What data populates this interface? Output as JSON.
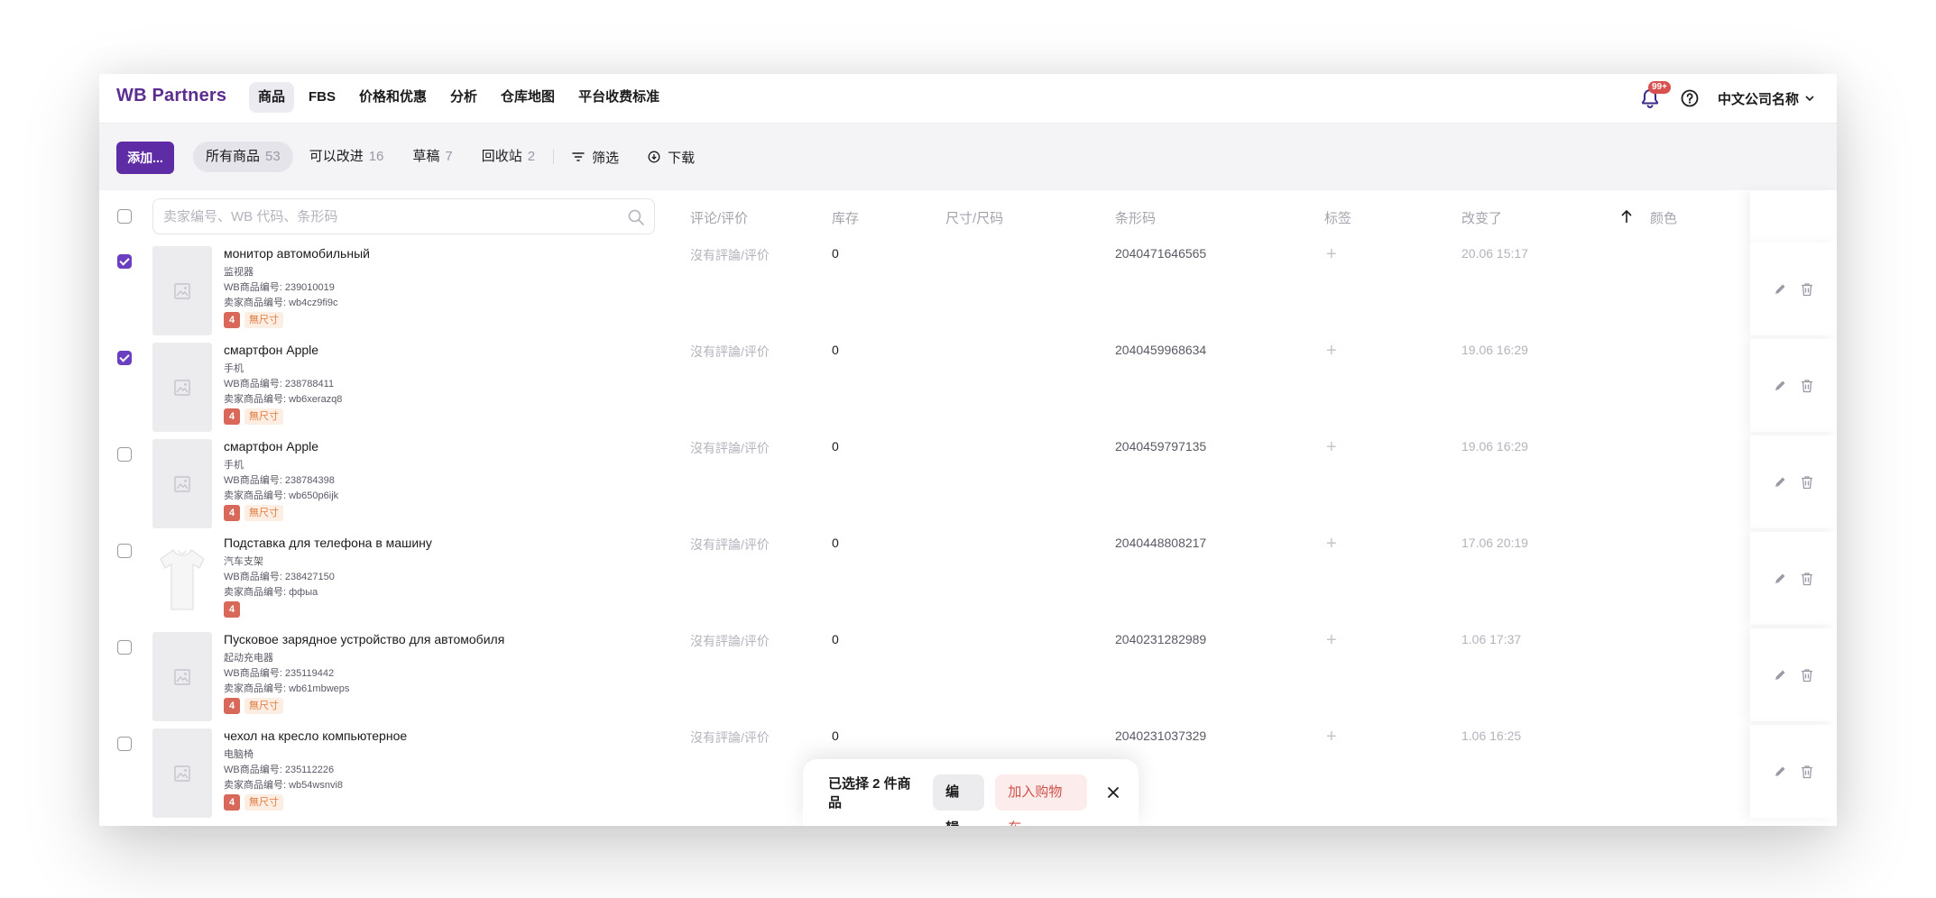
{
  "app": {
    "brand": "WB Partners"
  },
  "nav": {
    "items": [
      "商品",
      "FBS",
      "价格和优惠",
      "分析",
      "仓库地图",
      "平台收费标准"
    ],
    "active": 0
  },
  "header": {
    "notification_badge": "99+",
    "company": "中文公司名称"
  },
  "toolbar": {
    "add_label": "添加...",
    "tabs": [
      {
        "label": "所有商品",
        "count": "53"
      },
      {
        "label": "可以改进",
        "count": "16"
      },
      {
        "label": "草稿",
        "count": "7"
      },
      {
        "label": "回收站",
        "count": "2"
      }
    ],
    "filter_label": "筛选",
    "download_label": "下载"
  },
  "table": {
    "search_placeholder": "卖家编号、WB 代码、条形码",
    "columns": {
      "reviews": "评论/评价",
      "stock": "库存",
      "size": "尺寸/尺码",
      "barcode": "条形码",
      "tags": "标签",
      "changed": "改变了",
      "color": "颜色"
    },
    "rows": [
      {
        "checked": true,
        "name": "монитор автомобильный",
        "category": "监视器",
        "wb_id": "WB商品编号: 239010019",
        "seller_id": "卖家商品编号: wb4cz9fi9c",
        "tag_num": "4",
        "tag_size": "無尺寸",
        "review": "沒有評論/评价",
        "stock": "0",
        "barcode": "2040471646565",
        "changed": "20.06 15:17",
        "photo": false
      },
      {
        "checked": true,
        "name": "смартфон Apple",
        "category": "手机",
        "wb_id": "WB商品编号: 238788411",
        "seller_id": "卖家商品编号: wb6xerazq8",
        "tag_num": "4",
        "tag_size": "無尺寸",
        "review": "沒有評論/评价",
        "stock": "0",
        "barcode": "2040459968634",
        "changed": "19.06 16:29",
        "photo": false
      },
      {
        "checked": false,
        "name": "смартфон Apple",
        "category": "手机",
        "wb_id": "WB商品编号: 238784398",
        "seller_id": "卖家商品编号: wb650p6ijk",
        "tag_num": "4",
        "tag_size": "無尺寸",
        "review": "沒有評論/评价",
        "stock": "0",
        "barcode": "2040459797135",
        "changed": "19.06 16:29",
        "photo": false
      },
      {
        "checked": false,
        "name": "Подставка для телефона в машину",
        "category": "汽车支架",
        "wb_id": "WB商品编号: 238427150",
        "seller_id": "卖家商品编号: ффыа",
        "tag_num": "4",
        "tag_size": "",
        "review": "沒有評論/评价",
        "stock": "0",
        "barcode": "2040448808217",
        "changed": "17.06 20:19",
        "photo": true
      },
      {
        "checked": false,
        "name": "Пусковое зарядное устройство для автомобиля",
        "category": "起动充电器",
        "wb_id": "WB商品编号: 235119442",
        "seller_id": "卖家商品编号: wb61mbweps",
        "tag_num": "4",
        "tag_size": "無尺寸",
        "review": "沒有評論/评价",
        "stock": "0",
        "barcode": "2040231282989",
        "changed": "1.06 17:37",
        "photo": false
      },
      {
        "checked": false,
        "name": "чехол на кресло компьютерное",
        "category": "电脑椅",
        "wb_id": "WB商品编号: 235112226",
        "seller_id": "卖家商品编号: wb54wsnvi8",
        "tag_num": "4",
        "tag_size": "無尺寸",
        "review": "沒有評論/评价",
        "stock": "0",
        "barcode": "2040231037329",
        "changed": "1.06 16:25",
        "photo": false
      }
    ]
  },
  "selection_bar": {
    "text": "已选择 2 件商品",
    "edit_label": "编辑",
    "cart_label": "加入购物车"
  },
  "colors": {
    "brand": "#5b2d8e",
    "primary": "#5e2ca5",
    "danger": "#d0504a",
    "tag": "#d8685a",
    "size_tag_text": "#e07b3f"
  }
}
